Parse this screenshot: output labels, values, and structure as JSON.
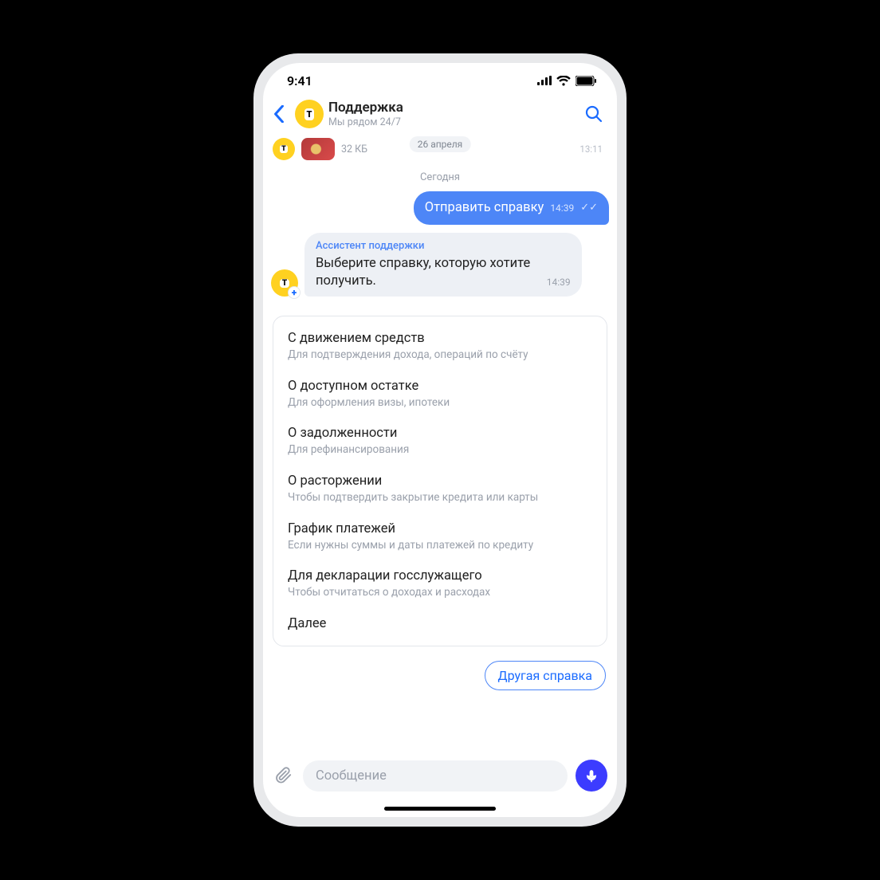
{
  "status": {
    "time": "9:41"
  },
  "header": {
    "title": "Поддержка",
    "subtitle": "Мы рядом 24/7",
    "avatar_letter": "T"
  },
  "previous": {
    "file_size": "32 КБ",
    "date_badge": "26 апреля",
    "time": "13:11"
  },
  "divider": "Сегодня",
  "outgoing": {
    "text": "Отправить справку",
    "time": "14:39"
  },
  "incoming": {
    "assistant_label": "Ассистент поддержки",
    "text": "Выберите справку, которую хотите получить.",
    "time": "14:39",
    "avatar_letter": "T"
  },
  "options": [
    {
      "title": "С движением средств",
      "subtitle": "Для подтверждения дохода, операций по счёту"
    },
    {
      "title": "О доступном остатке",
      "subtitle": "Для оформления визы, ипотеки"
    },
    {
      "title": "О задолженности",
      "subtitle": "Для рефинансирования"
    },
    {
      "title": "О расторжении",
      "subtitle": "Чтобы подтвердить закрытие кредита или карты"
    },
    {
      "title": "График платежей",
      "subtitle": "Если нужны суммы и даты платежей по кредиту"
    },
    {
      "title": "Для декларации госслужащего",
      "subtitle": "Чтобы отчитаться о доходах и расходах"
    }
  ],
  "next_label": "Далее",
  "chip": "Другая справка",
  "input": {
    "placeholder": "Сообщение"
  }
}
